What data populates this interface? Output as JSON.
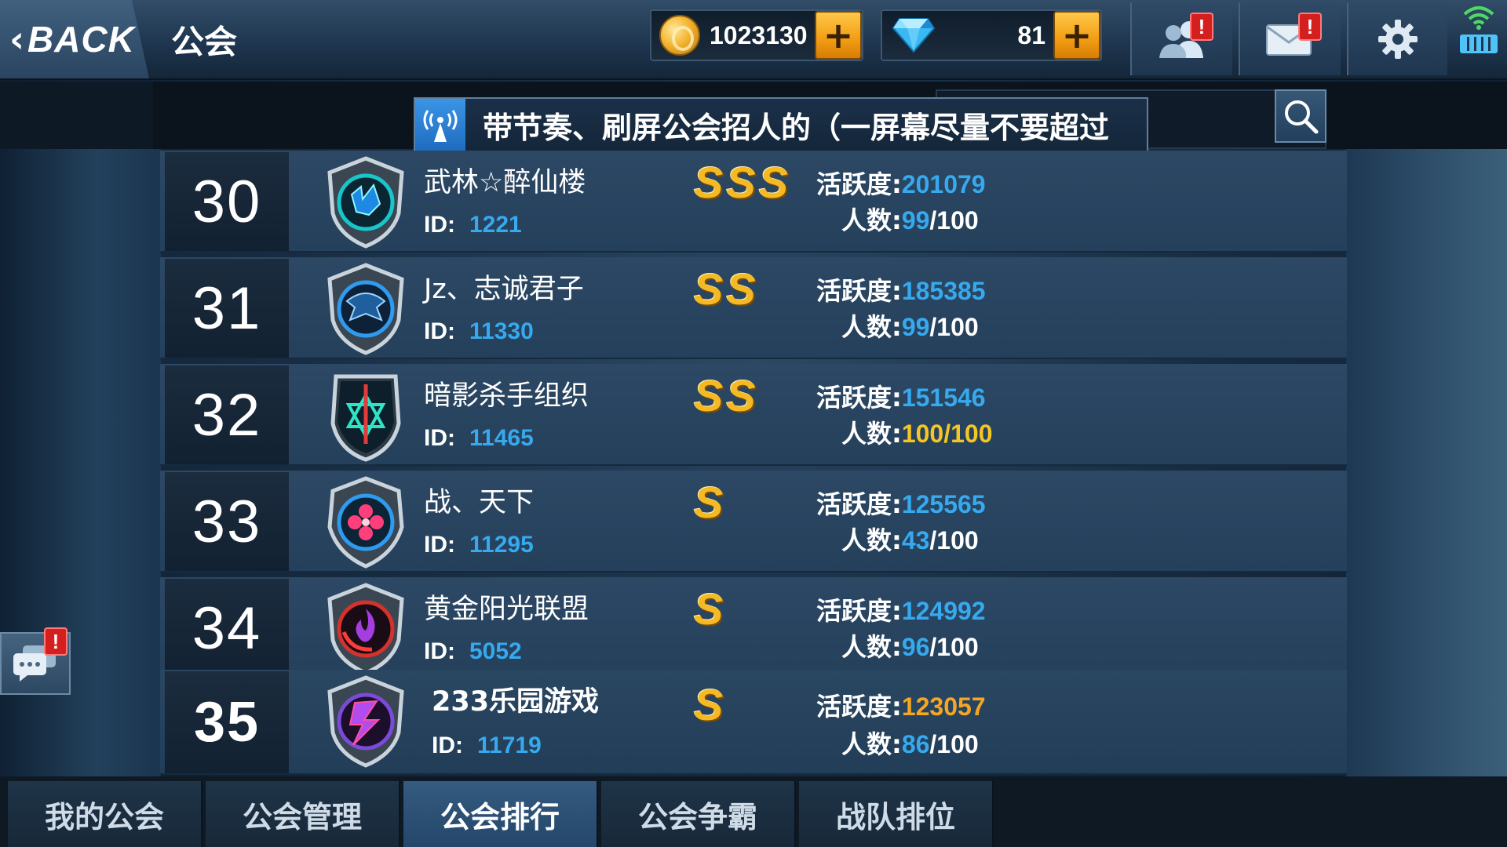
{
  "header": {
    "back_label": "BACK",
    "title": "公会",
    "gold": "1023130",
    "gems": "81",
    "plus": "+",
    "notification_badge": "!"
  },
  "broadcast": {
    "message": "带节奏、刷屏公会招人的（一屏幕尽量不要超过",
    "search_placeholder": ""
  },
  "guilds": [
    {
      "rank": "30",
      "name": "武林☆醉仙楼",
      "id_label": "ID:",
      "id": "1221",
      "grade": "SSS",
      "activity_label": "活跃度:",
      "activity": "201079",
      "members_label": "人数:",
      "members": "99",
      "max": "/100"
    },
    {
      "rank": "31",
      "name": "Jz、志诚君子",
      "id_label": "ID:",
      "id": "11330",
      "grade": "SS",
      "activity_label": "活跃度:",
      "activity": "185385",
      "members_label": "人数:",
      "members": "99",
      "max": "/100"
    },
    {
      "rank": "32",
      "name": "暗影杀手组织",
      "id_label": "ID:",
      "id": "11465",
      "grade": "SS",
      "activity_label": "活跃度:",
      "activity": "151546",
      "members_label": "人数:",
      "members": "100",
      "max": "/100"
    },
    {
      "rank": "33",
      "name": "战、天下",
      "id_label": "ID:",
      "id": "11295",
      "grade": "S",
      "activity_label": "活跃度:",
      "activity": "125565",
      "members_label": "人数:",
      "members": "43",
      "max": "/100"
    },
    {
      "rank": "34",
      "name": "黄金阳光联盟",
      "id_label": "ID:",
      "id": "5052",
      "grade": "S",
      "activity_label": "活跃度:",
      "activity": "124992",
      "members_label": "人数:",
      "members": "96",
      "max": "/100"
    },
    {
      "rank": "35",
      "name": "233乐园游戏",
      "id_label": "ID:",
      "id": "11719",
      "grade": "S",
      "activity_label": "活跃度:",
      "activity": "123057",
      "members_label": "人数:",
      "members": "86",
      "max": "/100"
    }
  ],
  "tabs": [
    {
      "label": "我的公会",
      "active": false
    },
    {
      "label": "公会管理",
      "active": false
    },
    {
      "label": "公会排行",
      "active": true
    },
    {
      "label": "公会争霸",
      "active": false
    },
    {
      "label": "战队排位",
      "active": false
    }
  ],
  "colors": {
    "value_blue": "#36a9ef",
    "highlight_gold": "#f5a623",
    "grade_gold": "#f5b925",
    "badge_red": "#d51f1f"
  },
  "icons": {
    "coin": "gold-coin-icon",
    "gem": "diamond-icon",
    "friends": "friends-icon",
    "mail": "mail-icon",
    "settings": "gear-icon",
    "wifi": "wifi-icon",
    "battery": "battery-icon",
    "broadcast": "broadcast-icon",
    "search": "search-icon",
    "chat": "chat-icon"
  }
}
